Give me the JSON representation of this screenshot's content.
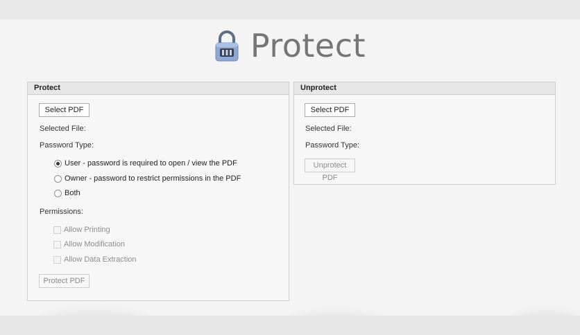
{
  "app": {
    "title": "Protect",
    "icon": "padlock-icon"
  },
  "colors": {
    "lock_body": "#8ea8d8",
    "lock_shackle": "#5f6d86",
    "lock_keypad": "#3a4050"
  },
  "protect_panel": {
    "header": "Protect",
    "select_button": "Select PDF",
    "selected_file_label": "Selected File:",
    "password_type_label": "Password Type:",
    "password_options": [
      {
        "label": "User - password is required to open / view the PDF",
        "checked": true
      },
      {
        "label": "Owner - password to restrict permissions in the PDF",
        "checked": false
      },
      {
        "label": "Both",
        "checked": false
      }
    ],
    "permissions_label": "Permissions:",
    "permissions": [
      {
        "label": "Allow Printing",
        "checked": false,
        "enabled": false
      },
      {
        "label": "Allow Modification",
        "checked": false,
        "enabled": false
      },
      {
        "label": "Allow Data Extraction",
        "checked": false,
        "enabled": false
      }
    ],
    "action_button": "Protect PDF"
  },
  "unprotect_panel": {
    "header": "Unprotect",
    "select_button": "Select PDF",
    "selected_file_label": "Selected File:",
    "password_type_label": "Password Type:",
    "action_button": "Unprotect PDF"
  }
}
